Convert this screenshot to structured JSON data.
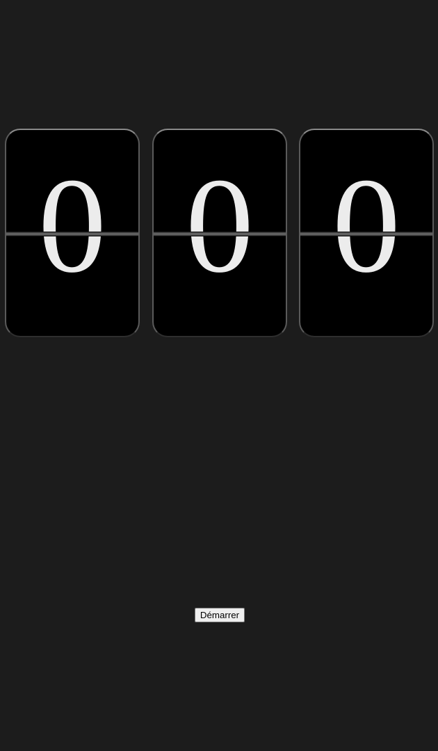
{
  "flip_counter": {
    "digits": [
      "0",
      "0",
      "0"
    ]
  },
  "controls": {
    "start_label": "Démarrer"
  }
}
